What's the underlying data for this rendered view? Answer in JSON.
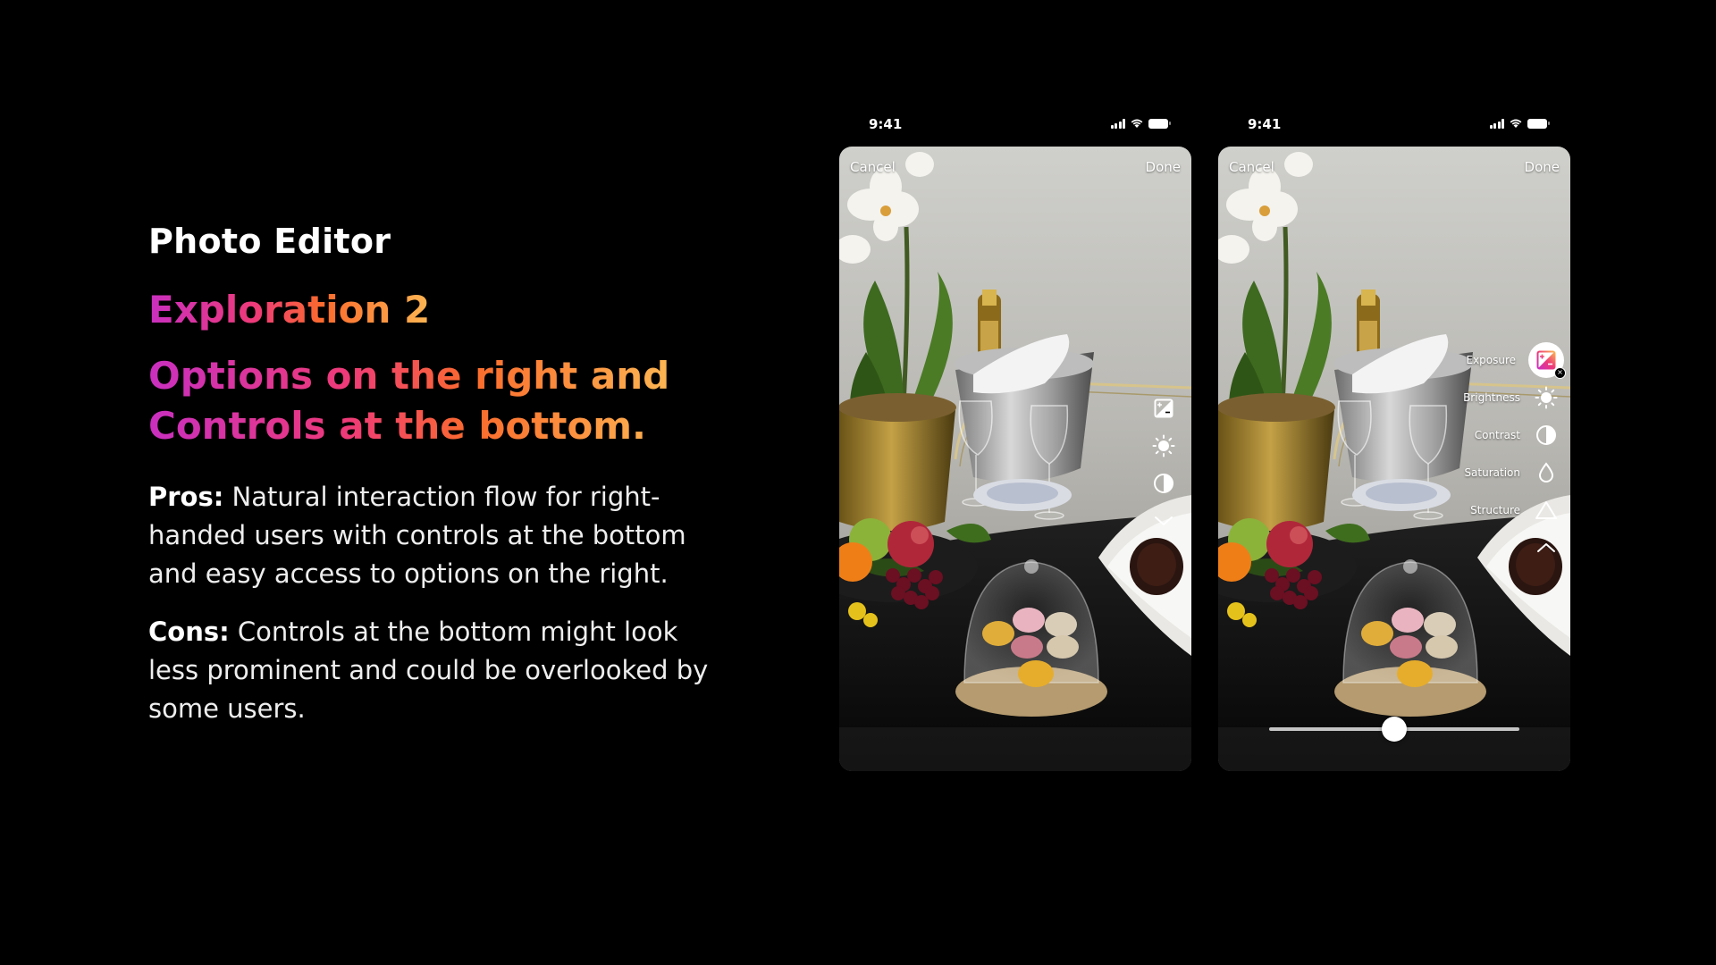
{
  "slide": {
    "kicker": "Photo Editor",
    "exploration": "Exploration 2",
    "headline_line1": "Options on the right and",
    "headline_line2": "Controls at the bottom.",
    "pros_label": "Pros:",
    "pros_text": " Natural interaction flow for right-handed users with controls at the bottom and easy access to options on the right.",
    "cons_label": "Cons:",
    "cons_text": " Controls at the bottom might look less prominent and could be overlooked by some users."
  },
  "phone1": {
    "time": "9:41",
    "cancel": "Cancel",
    "done": "Done",
    "tools": [
      "exposure-icon",
      "brightness-icon",
      "contrast-icon",
      "chevron-down-icon"
    ]
  },
  "phone2": {
    "time": "9:41",
    "cancel": "Cancel",
    "done": "Done",
    "tools": [
      {
        "label": "Exposure",
        "icon": "exposure-icon",
        "selected": true
      },
      {
        "label": "Brightness",
        "icon": "brightness-icon"
      },
      {
        "label": "Contrast",
        "icon": "contrast-icon"
      },
      {
        "label": "Saturation",
        "icon": "saturation-icon"
      },
      {
        "label": "Structure",
        "icon": "structure-icon"
      }
    ],
    "collapse_icon": "chevron-up-icon",
    "slider_value": 0.5
  },
  "colors": {
    "gradient": [
      "#c92fc0",
      "#ee3a78",
      "#fb6b2c",
      "#fdb552"
    ],
    "background": "#000000"
  }
}
